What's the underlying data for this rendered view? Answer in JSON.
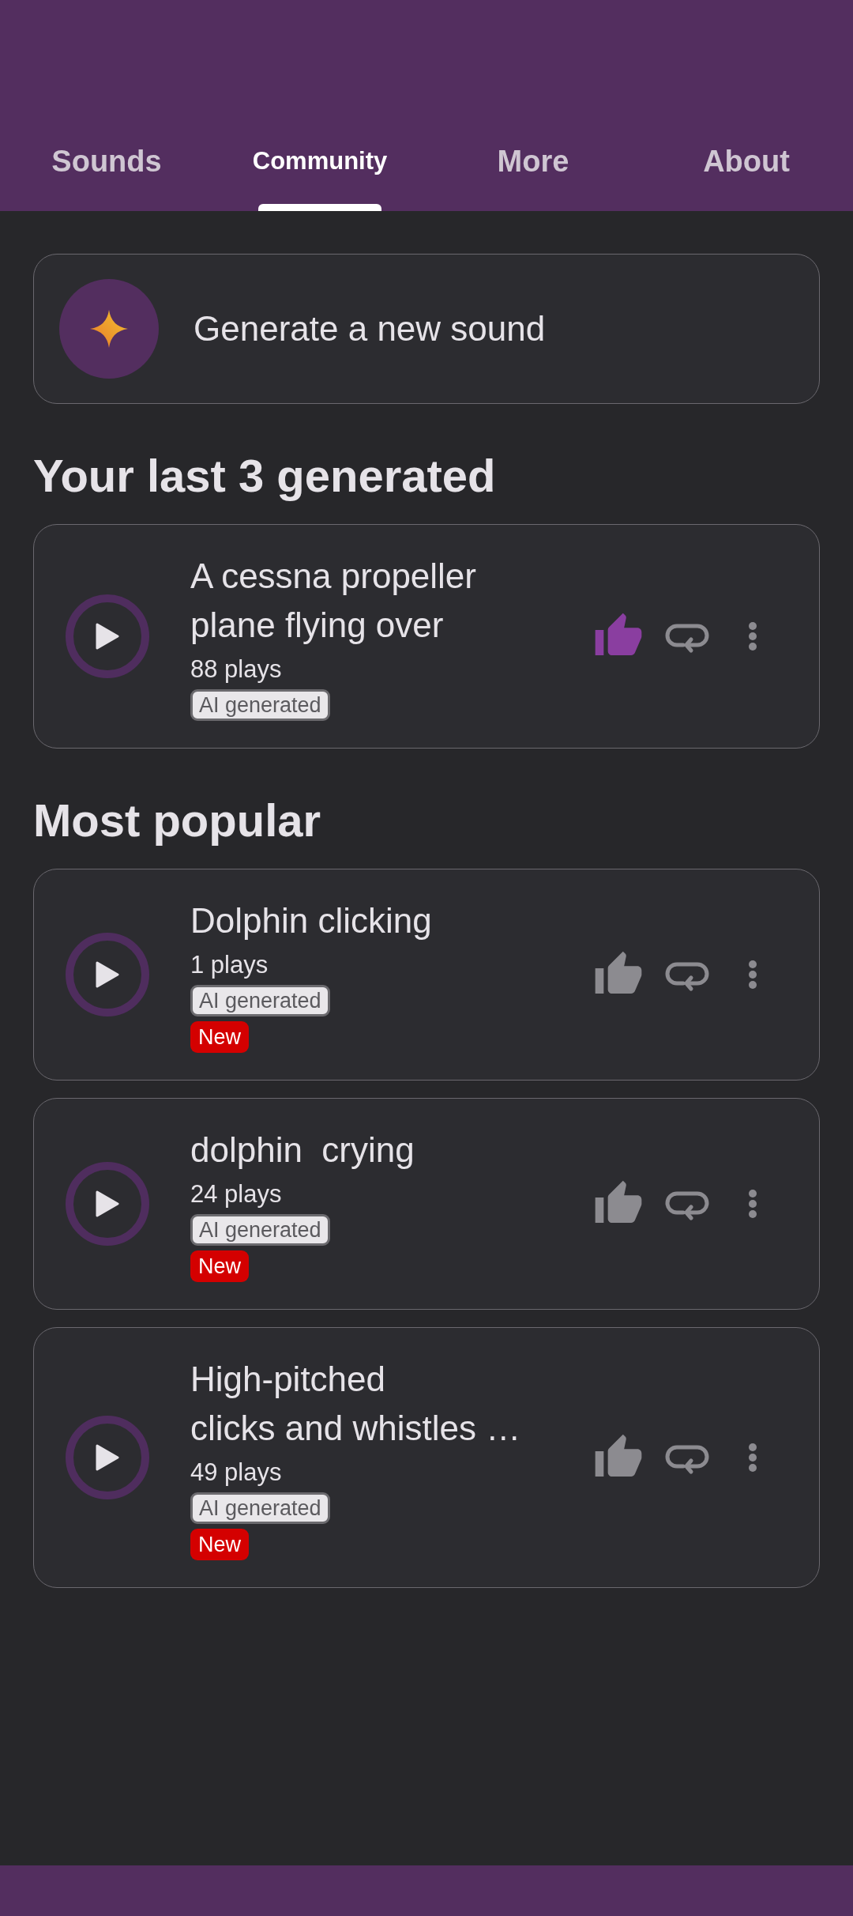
{
  "tabs": [
    {
      "label": "Sounds",
      "selected": false
    },
    {
      "label": "Community",
      "selected": true
    },
    {
      "label": "More",
      "selected": false
    },
    {
      "label": "About",
      "selected": false
    }
  ],
  "generate_button": {
    "label": "Generate a new sound"
  },
  "sections": [
    {
      "heading": "Your last 3 generated",
      "sounds": [
        {
          "title_lines": [
            "A cessna propeller",
            "plane flying over"
          ],
          "plays": "88 plays",
          "liked": true,
          "badges": [
            {
              "kind": "ai",
              "label": "AI generated"
            }
          ]
        }
      ]
    },
    {
      "heading": "Most popular",
      "sounds": [
        {
          "title_lines": [
            "Dolphin clicking"
          ],
          "plays": "1 plays",
          "liked": false,
          "badges": [
            {
              "kind": "ai",
              "label": "AI generated"
            },
            {
              "kind": "new",
              "label": "New"
            }
          ]
        },
        {
          "title_lines": [
            "dolphin  crying"
          ],
          "plays": "24 plays",
          "liked": false,
          "badges": [
            {
              "kind": "ai",
              "label": "AI generated"
            },
            {
              "kind": "new",
              "label": "New"
            }
          ]
        },
        {
          "title_lines": [
            "High-pitched",
            "clicks and whistles …"
          ],
          "plays": "49 plays",
          "liked": false,
          "badges": [
            {
              "kind": "ai",
              "label": "AI generated"
            },
            {
              "kind": "new",
              "label": "New"
            }
          ]
        }
      ]
    }
  ]
}
